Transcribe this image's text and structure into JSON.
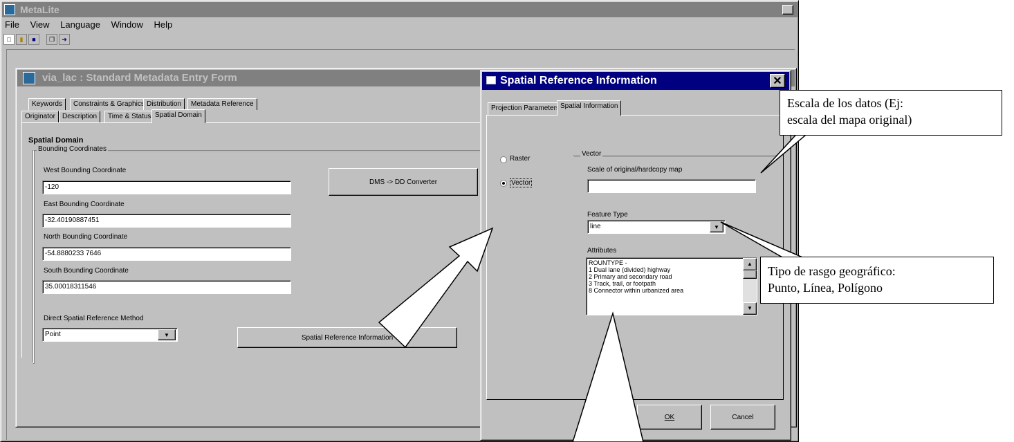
{
  "app": {
    "title": "MetaLite"
  },
  "menubar": [
    "File",
    "View",
    "Language",
    "Window",
    "Help"
  ],
  "form": {
    "title": "via_lac : Standard Metadata Entry Form",
    "tabs_top": [
      "Keywords",
      "Constraints & Graphics",
      "Distribution",
      "Metadata Reference"
    ],
    "tabs_bottom": [
      "Originator",
      "Description",
      "Time & Status",
      "Spatial Domain"
    ],
    "section": "Spatial Domain",
    "group": "Bounding Coordinates",
    "west_label": "West Bounding Coordinate",
    "west_value": "-120",
    "east_label": "East Bounding Coordinate",
    "east_value": "-32.40190887451",
    "north_label": "North Bounding Coordinate",
    "north_value": "-54.8880233 7646",
    "south_label": "South Bounding Coordinate",
    "south_value": "35.00018311546",
    "converter_label": "DMS -> DD Converter",
    "method_label": "Direct Spatial Reference Method",
    "method_value": "Point",
    "sri_button": "Spatial Reference Information"
  },
  "dialog": {
    "title": "Spatial Reference Information",
    "tabs": [
      "Projection Parameters",
      "Spatial Information"
    ],
    "raster_label": "Raster",
    "vector_label": "Vector",
    "vector_group": "Vector",
    "scale_label": "Scale of original/hardcopy map",
    "scale_value": "",
    "feature_label": "Feature Type",
    "feature_value": "line",
    "attributes_label": "Attributes",
    "attributes": [
      "ROUNTYPE -",
      "1 Dual lane (divided) highway",
      "2 Primary and secondary road",
      "3 Track, trail, or footpath",
      "8 Connector within urbanized area"
    ],
    "ok": "OK",
    "cancel": "Cancel"
  },
  "callouts": {
    "scale": [
      "Escala de los datos  (Ej:",
      "escala del mapa original)"
    ],
    "feature": [
      "Tipo de rasgo geográfico:",
      "Punto, Línea, Polígono"
    ]
  },
  "colors": {
    "active_title": "#000080",
    "inactive_title": "#808080",
    "face": "#c0c0c0"
  }
}
